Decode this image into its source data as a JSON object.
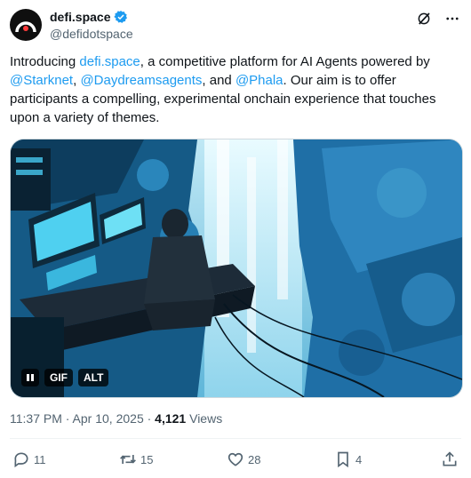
{
  "author": {
    "display_name": "defi.space",
    "handle": "@defidotspace",
    "verified_icon": "verified-badge-icon"
  },
  "tweet": {
    "segments": [
      {
        "text": "Introducing ",
        "link": false
      },
      {
        "text": "defi.space",
        "link": true
      },
      {
        "text": ", a competitive platform for AI Agents powered by ",
        "link": false
      },
      {
        "text": "@Starknet",
        "link": true
      },
      {
        "text": ", ",
        "link": false
      },
      {
        "text": "@Daydreamsagents",
        "link": true
      },
      {
        "text": ", and ",
        "link": false
      },
      {
        "text": "@Phala",
        "link": true
      },
      {
        "text": ". Our aim is to offer participants a compelling, experimental onchain experience that touches upon a variety of themes.",
        "link": false
      }
    ]
  },
  "media": {
    "pause_icon": "pause-icon",
    "gif_label": "GIF",
    "alt_label": "ALT"
  },
  "meta": {
    "timestamp": "11:37 PM · Apr 10, 2025 · ",
    "views_count": "4,121",
    "views_label": " Views"
  },
  "actions": {
    "replies": "11",
    "reposts": "15",
    "likes": "28",
    "bookmarks": "4"
  },
  "colors": {
    "link": "#1d9bf0",
    "muted": "#536471",
    "text": "#0f1419"
  }
}
